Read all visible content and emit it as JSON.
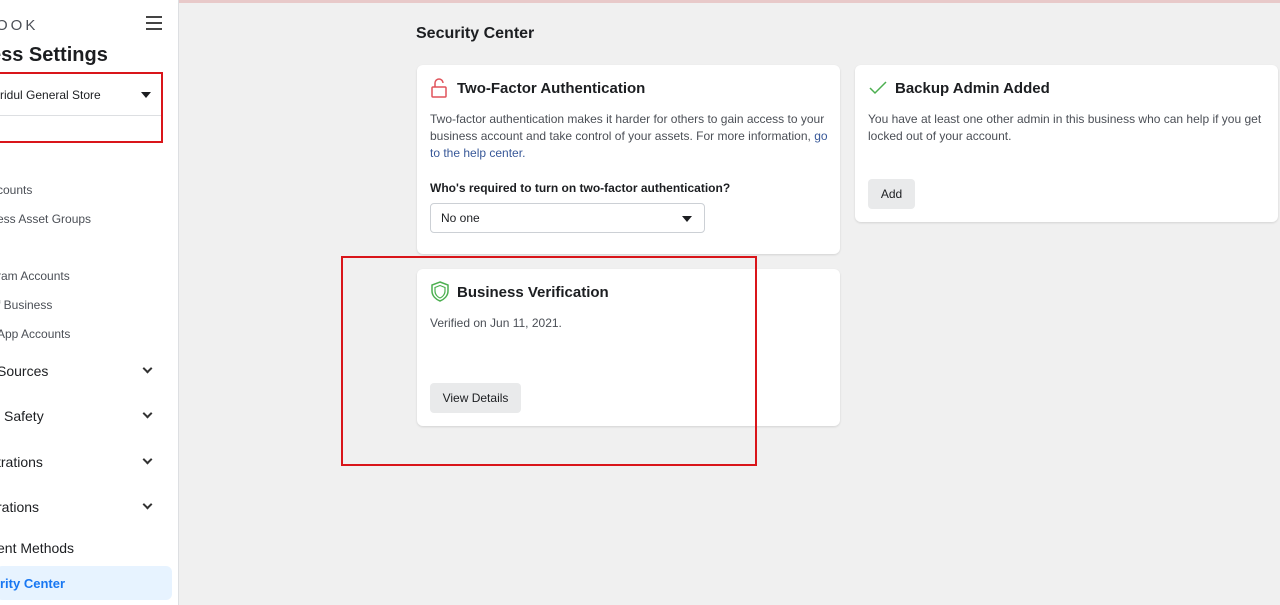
{
  "sidebar": {
    "brand": "OOK",
    "menu_icon": "hamburger-icon",
    "title": "ess Settings",
    "account": {
      "name": "ridul General Store",
      "icon": "caret-down-icon"
    },
    "items": [
      {
        "label": "counts"
      },
      {
        "label": "ess Asset Groups"
      },
      {
        "label": "ram Accounts"
      },
      {
        "label": "f Business"
      },
      {
        "label": "App Accounts"
      }
    ],
    "sections": [
      {
        "label": "Sources",
        "icon": "chevron-down-icon"
      },
      {
        "label": "l Safety",
        "icon": "chevron-down-icon"
      },
      {
        "label": "trations",
        "icon": "chevron-down-icon"
      },
      {
        "label": "rations",
        "icon": "chevron-down-icon"
      }
    ],
    "payment_label": "ent Methods",
    "active_label": "rity Center"
  },
  "main": {
    "title": "Security Center",
    "two_factor": {
      "icon": "unlock-icon",
      "title": "Two-Factor Authentication",
      "description": "Two-factor authentication makes it harder for others to gain access to your business account and take control of your assets. For more information, ",
      "link": "go to the help center.",
      "question": "Who's required to turn on two-factor authentication?",
      "select_value": "No one"
    },
    "backup_admin": {
      "icon": "checkmark-icon",
      "title": "Backup Admin Added",
      "description": "You have at least one other admin in this business who can help if you get locked out of your account.",
      "button": "Add"
    },
    "verification": {
      "icon": "shield-icon",
      "title": "Business Verification",
      "description": "Verified on Jun 11, 2021.",
      "button": "View Details"
    }
  },
  "colors": {
    "highlight": "#d9151a",
    "accent": "#1877f2",
    "active_bg": "#e7f3ff",
    "success": "#4caf50",
    "warning": "#e0525a"
  }
}
